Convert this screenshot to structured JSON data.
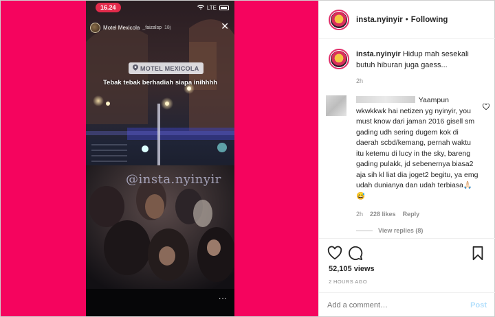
{
  "colors": {
    "media_bg": "#f5045e",
    "accent_ring": "#e1306c",
    "post_disabled": "#b2dffc",
    "meta_gray": "#8e8e8e"
  },
  "story": {
    "time": "16.24",
    "network": "LTE",
    "username": "Motel Mexicola",
    "secondary_user": "_faizalsp",
    "age": "18j",
    "location": "MOTEL MEXICOLA",
    "caption": "Tebak tebak berhadiah siapa inihhhh",
    "watermark": "@insta.nyinyir",
    "more": "..."
  },
  "header": {
    "username": "insta.nyinyir",
    "separator": "•",
    "follow_state": "Following"
  },
  "caption": {
    "username": "insta.nyinyir",
    "text": "Hidup mah sesekali butuh hiburan juga gaess...",
    "time": "2h"
  },
  "comment": {
    "text": "Yaampun wkwkkwk hai netizen yg nyinyir, you must know dari jaman 2016 gisell sm gading udh sering dugem kok di daerah scbd/kemang, pernah waktu itu ketemu di lucy in the sky, bareng gading pulakk, jd sebenernya biasa2 aja sih kl liat dia joget2 begitu, ya emg udah dunianya dan udah terbiasa🙏🏻😅",
    "time": "2h",
    "likes": "228 likes",
    "reply": "Reply",
    "view_replies": "View replies (8)"
  },
  "stats": {
    "views": "52,105 views",
    "posted": "2 HOURS AGO"
  },
  "composer": {
    "placeholder": "Add a comment…",
    "post": "Post"
  },
  "icons": [
    "heart-icon",
    "comment-icon",
    "bookmark-icon",
    "close-icon",
    "like-comment-icon"
  ]
}
